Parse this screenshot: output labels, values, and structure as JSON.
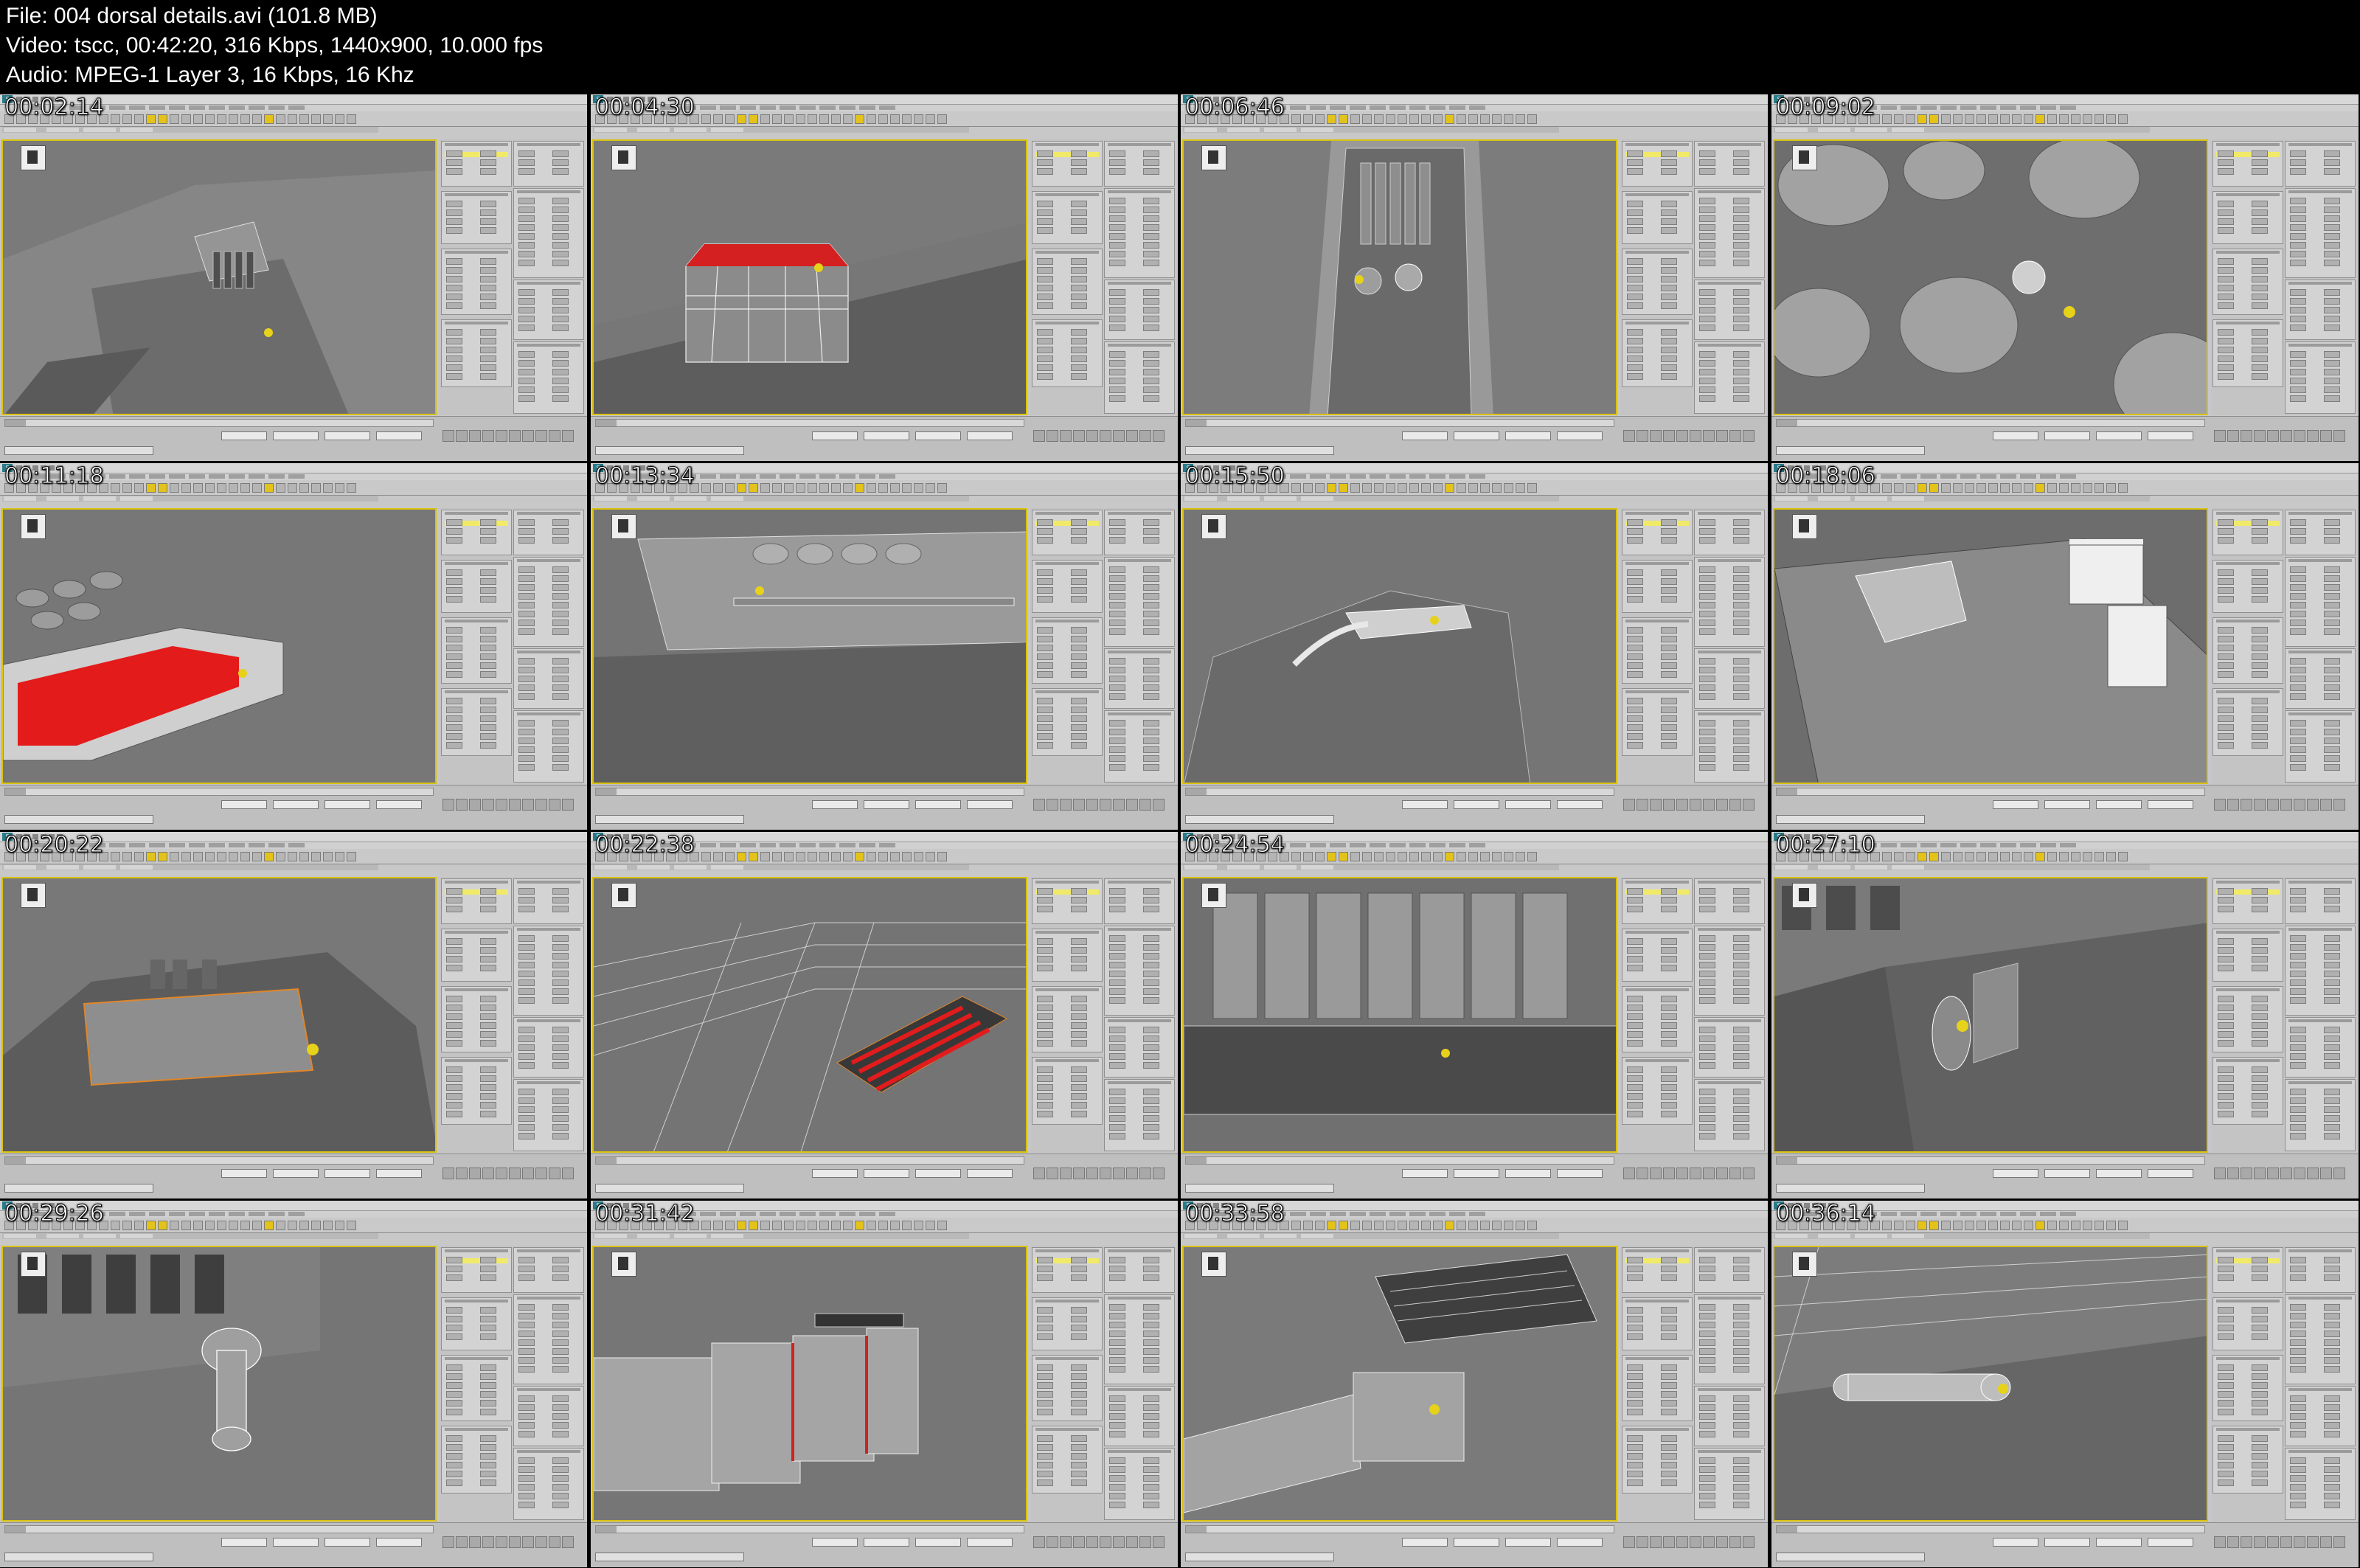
{
  "header": {
    "file_line": "File: 004 dorsal details.avi (101.8 MB)",
    "video_line": "Video: tscc, 00:42:20, 316 Kbps, 1440x900, 10.000 fps",
    "audio_line": "Audio: MPEG-1 Layer 3, 16 Kbps, 16 Khz"
  },
  "thumbnails": [
    {
      "timestamp": "00:02:14",
      "scene": "overview-vents"
    },
    {
      "timestamp": "00:04:30",
      "scene": "cylinder-red-top"
    },
    {
      "timestamp": "00:06:46",
      "scene": "slot-spheres"
    },
    {
      "timestamp": "00:09:02",
      "scene": "domes"
    },
    {
      "timestamp": "00:11:18",
      "scene": "red-panel-domes"
    },
    {
      "timestamp": "00:13:34",
      "scene": "hull-edge-domes"
    },
    {
      "timestamp": "00:15:50",
      "scene": "cockpit-wire"
    },
    {
      "timestamp": "00:18:06",
      "scene": "context-menu"
    },
    {
      "timestamp": "00:20:22",
      "scene": "hull-box-orange"
    },
    {
      "timestamp": "00:22:38",
      "scene": "red-vents-wire"
    },
    {
      "timestamp": "00:24:54",
      "scene": "vent-grid"
    },
    {
      "timestamp": "00:27:10",
      "scene": "side-disc"
    },
    {
      "timestamp": "00:29:26",
      "scene": "vent-cylinder"
    },
    {
      "timestamp": "00:31:42",
      "scene": "big-cylinder-red"
    },
    {
      "timestamp": "00:33:58",
      "scene": "cylinder-vents"
    },
    {
      "timestamp": "00:36:14",
      "scene": "small-cylinder-far"
    }
  ]
}
